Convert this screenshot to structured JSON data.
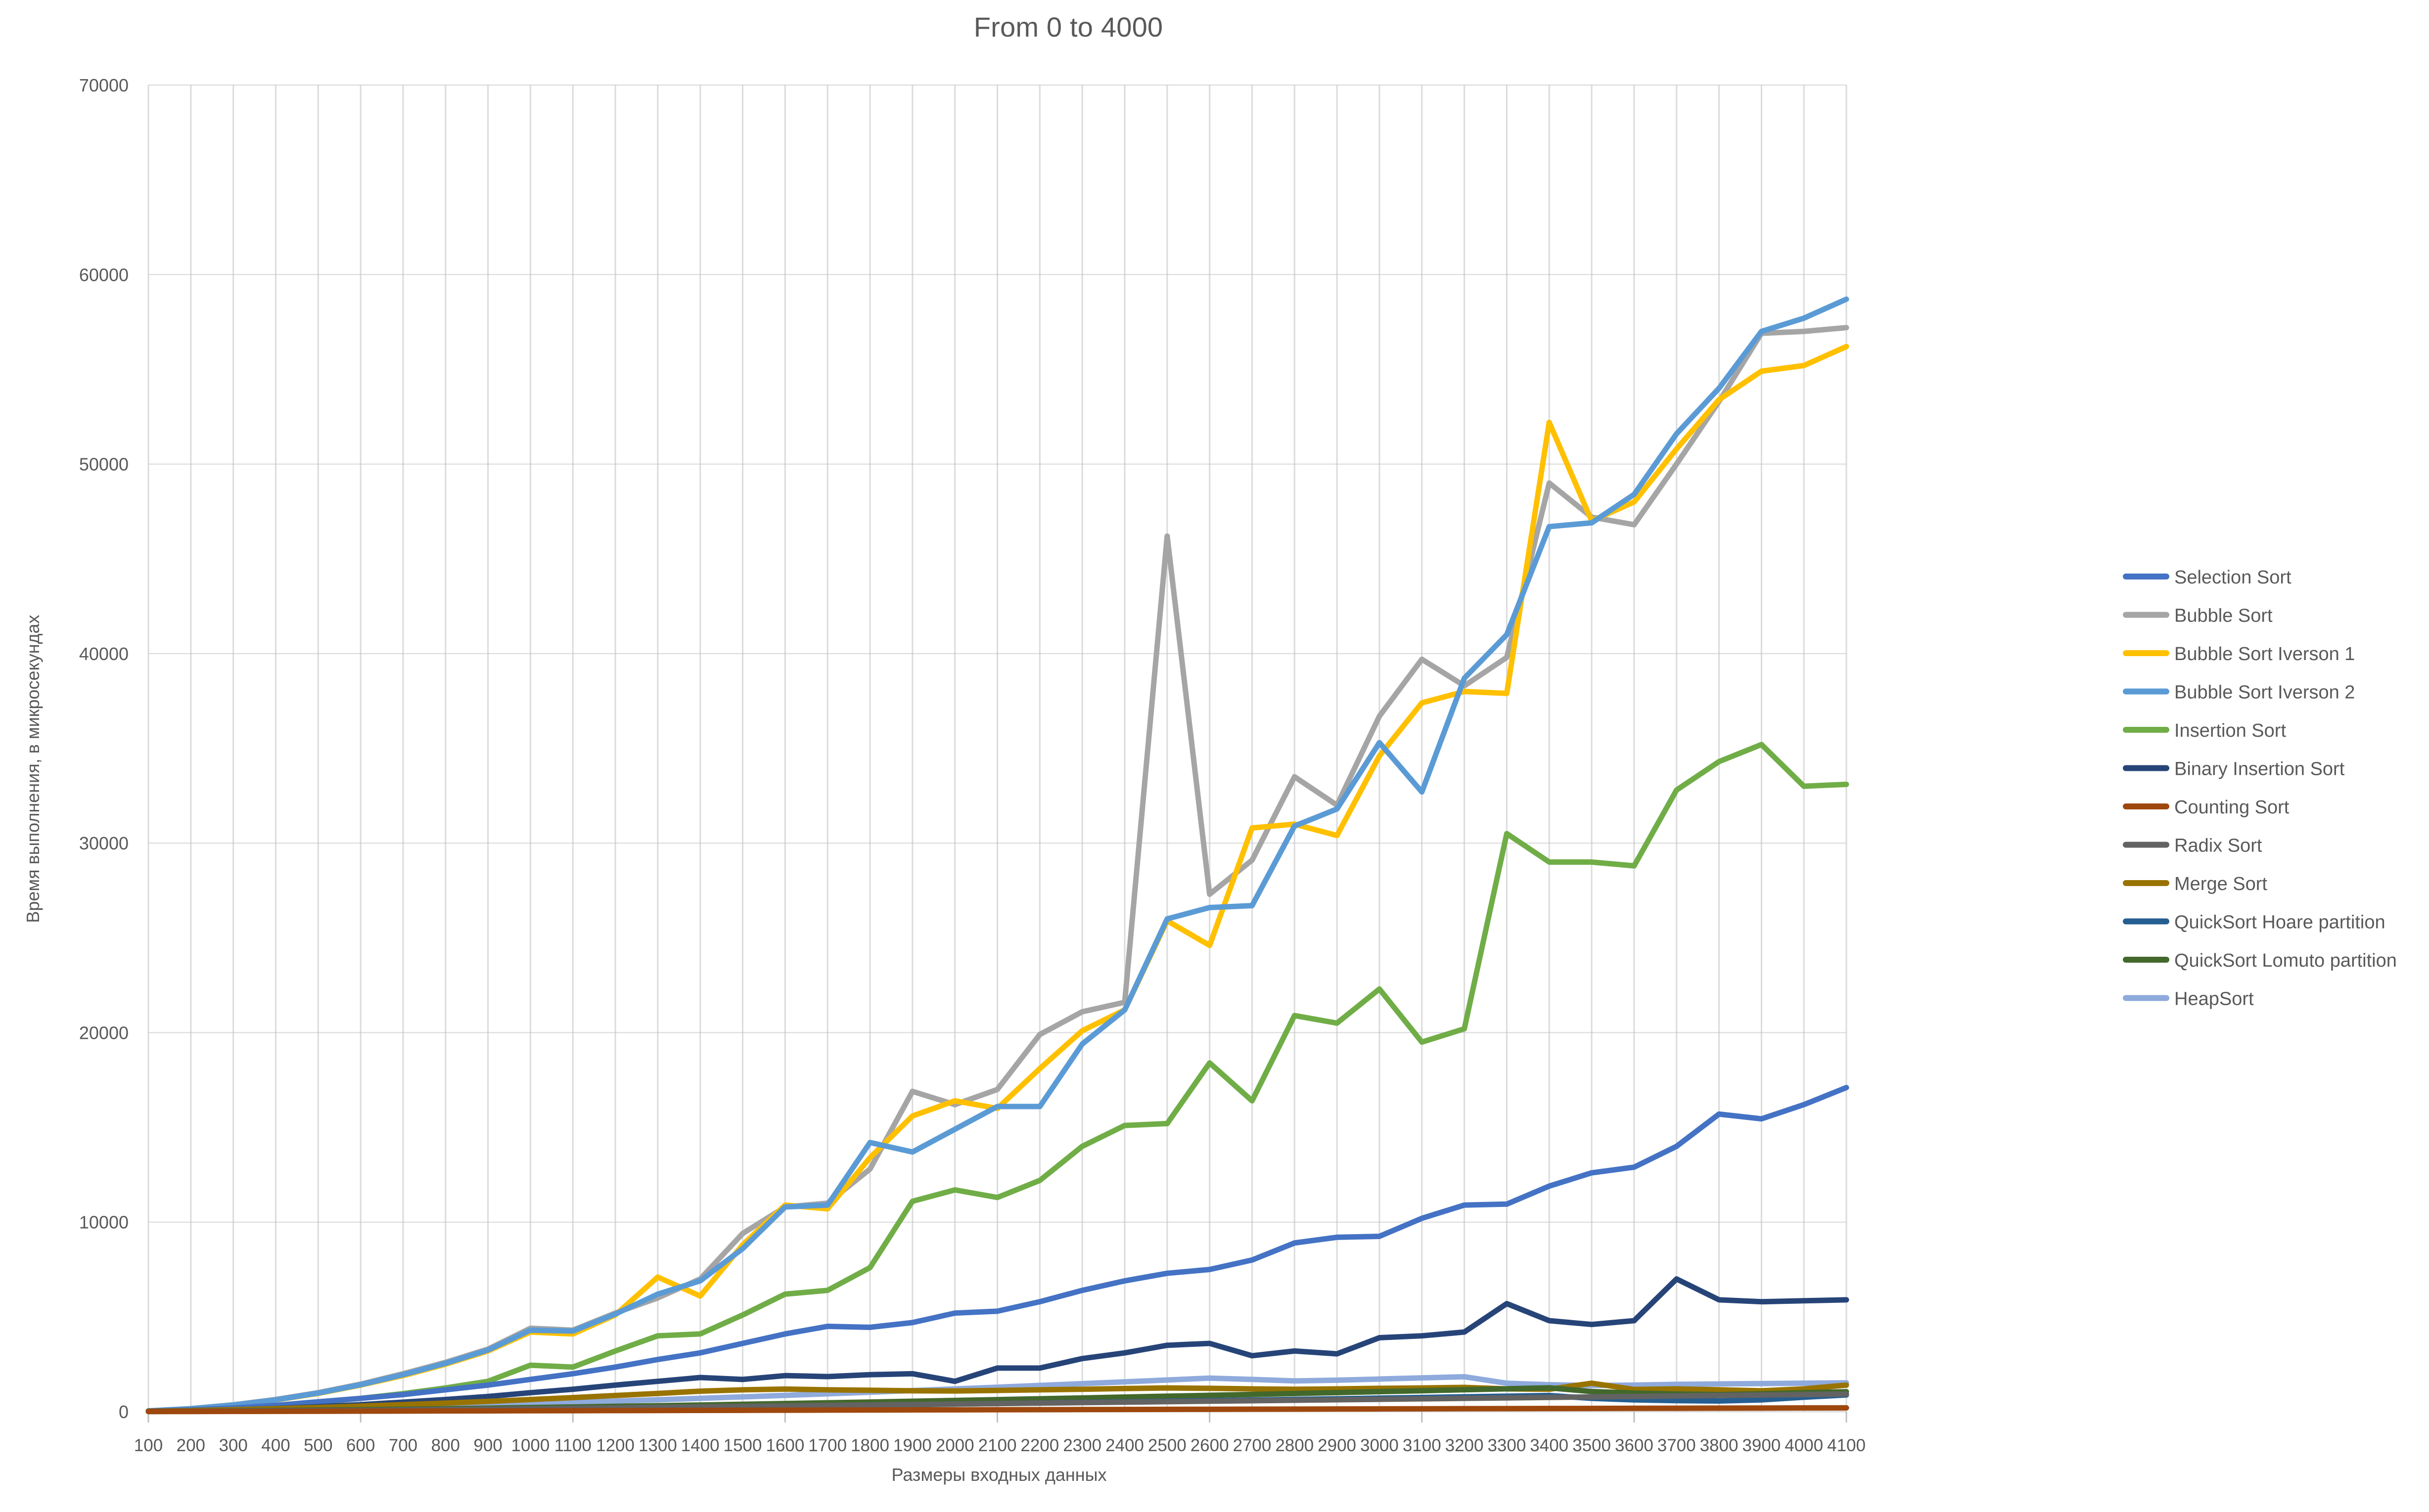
{
  "chart_data": {
    "type": "line",
    "title": "From 0 to 4000",
    "xlabel": "Размеры  входных данных",
    "ylabel": "Время выполнения, в микросекундах",
    "ylim": [
      0,
      70000
    ],
    "ytick_step": 10000,
    "yticks": [
      "0",
      "10000",
      "20000",
      "30000",
      "40000",
      "50000",
      "60000",
      "70000"
    ],
    "grid": "horizontal-and-vertical",
    "legend_position": "right",
    "categories": [
      100,
      200,
      300,
      400,
      500,
      600,
      700,
      800,
      900,
      1000,
      1100,
      1200,
      1300,
      1400,
      1500,
      1600,
      1700,
      1800,
      1900,
      2000,
      2100,
      2200,
      2300,
      2400,
      2500,
      2600,
      2700,
      2800,
      2900,
      3000,
      3100,
      3200,
      3300,
      3400,
      3500,
      3600,
      3700,
      3800,
      3900,
      4000,
      4100
    ],
    "series": [
      {
        "name": "Selection Sort",
        "color": "#4472C4",
        "values": [
          30,
          90,
          190,
          330,
          520,
          700,
          900,
          1150,
          1400,
          1700,
          2000,
          2350,
          2750,
          3100,
          3600,
          4100,
          4500,
          4450,
          4700,
          5200,
          5300,
          5800,
          6400,
          6900,
          7300,
          7500,
          8000,
          8900,
          9200,
          9250,
          10200,
          10900,
          10950,
          11900,
          12600,
          12900,
          14000,
          15700,
          15450,
          16200,
          17100
        ]
      },
      {
        "name": "Bubble Sort",
        "color": "#A5A5A5",
        "values": [
          40,
          160,
          360,
          640,
          1000,
          1450,
          2000,
          2600,
          3300,
          4400,
          4300,
          5200,
          6000,
          7000,
          9400,
          10800,
          11000,
          12800,
          16900,
          16200,
          17000,
          19900,
          21100,
          21600,
          46200,
          27300,
          29100,
          33500,
          32000,
          36700,
          39700,
          38300,
          39800,
          49000,
          47200,
          46800,
          50000,
          53300,
          56900,
          57000,
          57200
        ]
      },
      {
        "name": "Bubble Sort Iverson 1",
        "color": "#FFC000",
        "values": [
          35,
          150,
          340,
          610,
          960,
          1400,
          1900,
          2500,
          3200,
          4200,
          4100,
          5100,
          7100,
          6100,
          8800,
          10900,
          10700,
          13400,
          15600,
          16400,
          16000,
          18100,
          20100,
          21200,
          25900,
          24600,
          30800,
          31000,
          30400,
          34600,
          37400,
          38000,
          37900,
          52200,
          47000,
          48000,
          50800,
          53400,
          54900,
          55200,
          56200
        ]
      },
      {
        "name": "Bubble Sort Iverson 2",
        "color": "#5B9BD5",
        "values": [
          38,
          155,
          350,
          620,
          980,
          1420,
          1950,
          2550,
          3250,
          4300,
          4250,
          5150,
          6200,
          6900,
          8600,
          10800,
          10900,
          14200,
          13700,
          14900,
          16100,
          16100,
          19400,
          21200,
          26000,
          26600,
          26700,
          30900,
          31800,
          35300,
          32700,
          38700,
          41000,
          46700,
          46900,
          48400,
          51600,
          54000,
          57000,
          57700,
          58700
        ]
      },
      {
        "name": "Insertion Sort",
        "color": "#70AD47",
        "values": [
          25,
          80,
          180,
          320,
          500,
          700,
          950,
          1250,
          1600,
          2450,
          2350,
          3200,
          4000,
          4100,
          5100,
          6200,
          6400,
          7600,
          11100,
          11700,
          11300,
          12200,
          14000,
          15100,
          15200,
          18400,
          16400,
          20900,
          20500,
          22300,
          19500,
          20200,
          30500,
          29000,
          29000,
          28800,
          32800,
          34300,
          35200,
          33000,
          33100
        ]
      },
      {
        "name": "Binary Insertion Sort",
        "color": "#264478",
        "values": [
          15,
          45,
          95,
          165,
          260,
          370,
          500,
          640,
          800,
          1000,
          1180,
          1400,
          1600,
          1800,
          1700,
          1900,
          1850,
          1950,
          2000,
          1600,
          2300,
          2300,
          2800,
          3100,
          3500,
          3600,
          2950,
          3200,
          3050,
          3900,
          4000,
          4200,
          5700,
          4800,
          4600,
          4800,
          7000,
          5900,
          5800,
          5850,
          5900
        ]
      },
      {
        "name": "Counting Sort",
        "color": "#9E480E",
        "values": [
          5,
          8,
          12,
          16,
          20,
          25,
          30,
          35,
          40,
          45,
          50,
          55,
          60,
          65,
          70,
          75,
          80,
          85,
          90,
          95,
          100,
          105,
          110,
          115,
          120,
          125,
          130,
          135,
          140,
          145,
          150,
          155,
          160,
          165,
          170,
          175,
          180,
          185,
          190,
          195,
          200
        ]
      },
      {
        "name": "Radix Sort",
        "color": "#636363",
        "values": [
          10,
          18,
          28,
          40,
          55,
          70,
          90,
          110,
          130,
          150,
          175,
          200,
          225,
          250,
          275,
          300,
          325,
          350,
          375,
          400,
          425,
          450,
          475,
          500,
          525,
          550,
          575,
          600,
          625,
          650,
          675,
          700,
          725,
          750,
          775,
          800,
          825,
          850,
          875,
          900,
          925
        ]
      },
      {
        "name": "Merge Sort",
        "color": "#997300",
        "values": [
          20,
          55,
          100,
          155,
          220,
          290,
          370,
          450,
          540,
          640,
          740,
          850,
          960,
          1080,
          1150,
          1190,
          1150,
          1130,
          1100,
          1090,
          1120,
          1150,
          1180,
          1220,
          1250,
          1230,
          1200,
          1180,
          1200,
          1230,
          1250,
          1280,
          1200,
          1180,
          1500,
          1170,
          1200,
          1150,
          1100,
          1200,
          1400
        ]
      },
      {
        "name": "QuickSort Hoare partition",
        "color": "#255E91",
        "values": [
          8,
          16,
          26,
          38,
          52,
          66,
          84,
          102,
          122,
          142,
          165,
          188,
          212,
          236,
          262,
          288,
          315,
          342,
          370,
          398,
          428,
          458,
          488,
          518,
          550,
          582,
          614,
          646,
          680,
          714,
          748,
          782,
          816,
          850,
          700,
          620,
          580,
          560,
          620,
          760,
          880
        ]
      },
      {
        "name": "QuickSort Lomuto partition",
        "color": "#43682B",
        "values": [
          12,
          24,
          40,
          58,
          80,
          102,
          128,
          155,
          184,
          214,
          246,
          280,
          314,
          350,
          388,
          426,
          466,
          506,
          548,
          590,
          634,
          678,
          722,
          768,
          814,
          860,
          908,
          956,
          1004,
          1054,
          1104,
          1154,
          1204,
          1256,
          1060,
          980,
          930,
          900,
          940,
          1000,
          1050
        ]
      },
      {
        "name": "HeapSort",
        "color": "#8FAADC",
        "values": [
          18,
          42,
          72,
          108,
          150,
          196,
          246,
          300,
          358,
          420,
          486,
          554,
          626,
          700,
          778,
          858,
          940,
          1025,
          1112,
          1200,
          1290,
          1382,
          1476,
          1572,
          1670,
          1768,
          1700,
          1620,
          1660,
          1720,
          1780,
          1840,
          1500,
          1420,
          1380,
          1400,
          1440,
          1460,
          1480,
          1500,
          1520
        ]
      }
    ]
  }
}
